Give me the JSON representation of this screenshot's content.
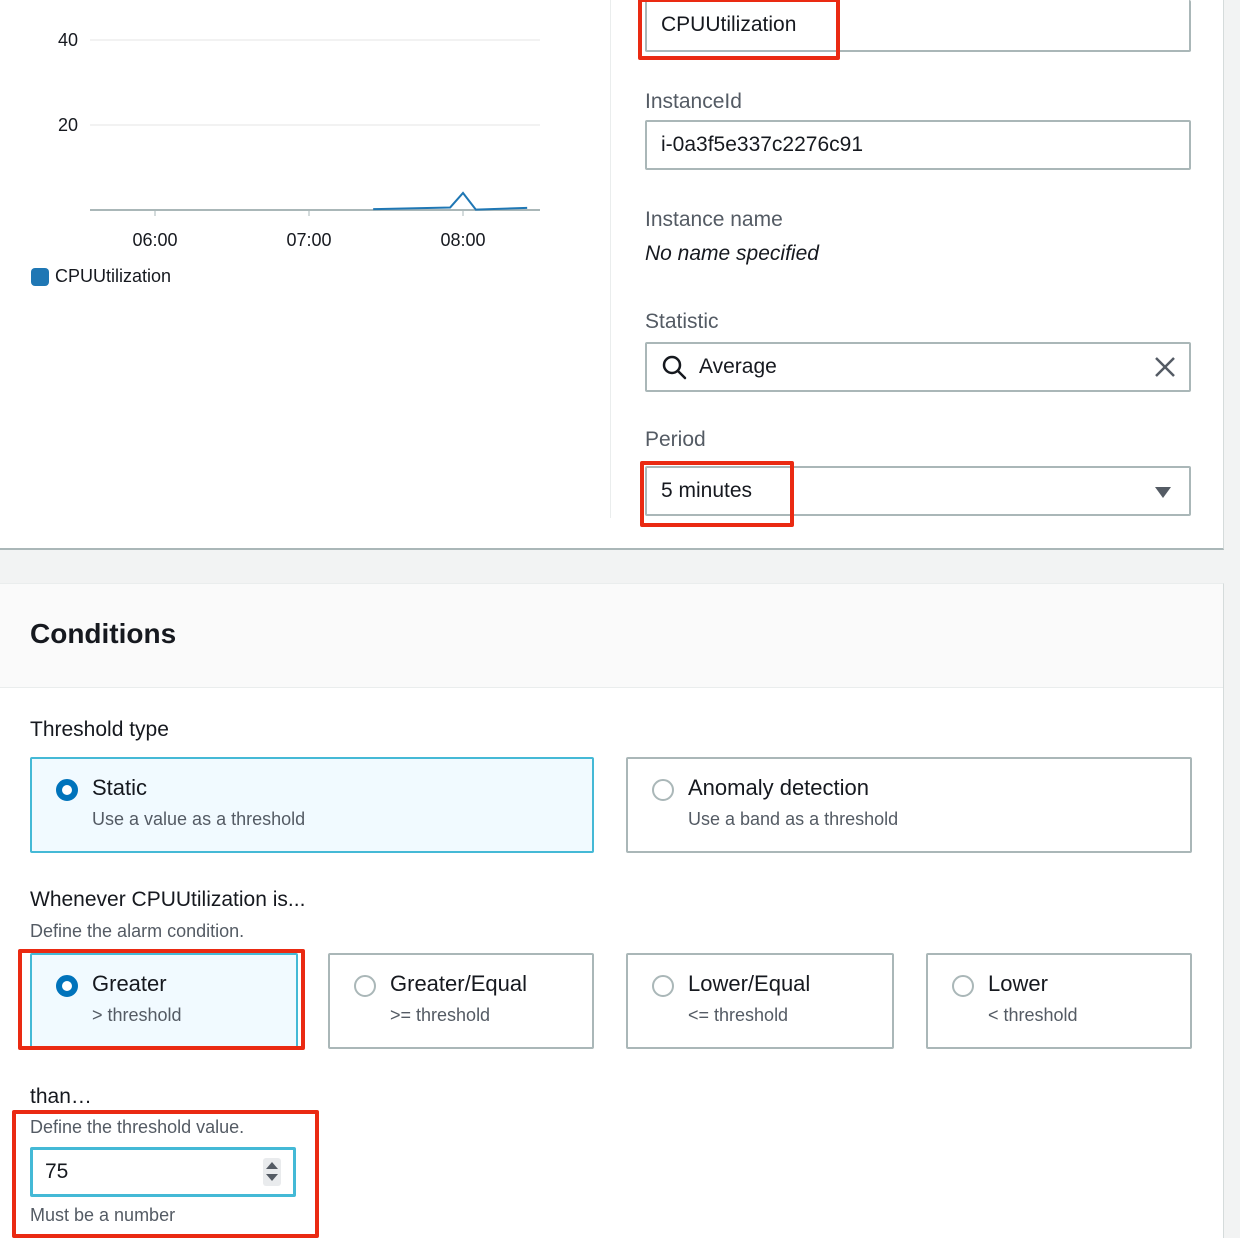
{
  "colors": {
    "accent": "#0073bb",
    "highlight": "#ea2a12",
    "focus": "#44b9d6",
    "series": "#1f77b4"
  },
  "chart_data": {
    "type": "line",
    "x": [
      "06:00",
      "07:00",
      "08:00"
    ],
    "yticks": [
      20,
      40
    ],
    "ylim": [
      0,
      45
    ],
    "series": [
      {
        "name": "CPUUtilization",
        "points": [
          {
            "t": "07:25",
            "y": 0.2
          },
          {
            "t": "07:55",
            "y": 0.6
          },
          {
            "t": "08:00",
            "y": 4.0
          },
          {
            "t": "08:05",
            "y": 0.1
          },
          {
            "t": "08:25",
            "y": 0.5
          }
        ]
      }
    ],
    "legend": "CPUUtilization",
    "grid": true
  },
  "metric": {
    "metric_name_value": "CPUUtilization",
    "instance_id_label": "InstanceId",
    "instance_id_value": "i-0a3f5e337c2276c91",
    "instance_name_label": "Instance name",
    "instance_name_value": "No name specified",
    "statistic_label": "Statistic",
    "statistic_value": "Average",
    "period_label": "Period",
    "period_value": "5 minutes"
  },
  "conditions": {
    "title": "Conditions",
    "threshold_type_label": "Threshold type",
    "threshold_types": [
      {
        "title": "Static",
        "sub": "Use a value as a threshold",
        "selected": true
      },
      {
        "title": "Anomaly detection",
        "sub": "Use a band as a threshold",
        "selected": false
      }
    ],
    "whenever_label": "Whenever CPUUtilization is...",
    "whenever_desc": "Define the alarm condition.",
    "operators": [
      {
        "title": "Greater",
        "sub": "> threshold",
        "selected": true
      },
      {
        "title": "Greater/Equal",
        "sub": ">= threshold",
        "selected": false
      },
      {
        "title": "Lower/Equal",
        "sub": "<= threshold",
        "selected": false
      },
      {
        "title": "Lower",
        "sub": "< threshold",
        "selected": false
      }
    ],
    "than_label": "than…",
    "than_desc": "Define the threshold value.",
    "threshold_value": "75",
    "threshold_hint": "Must be a number"
  }
}
